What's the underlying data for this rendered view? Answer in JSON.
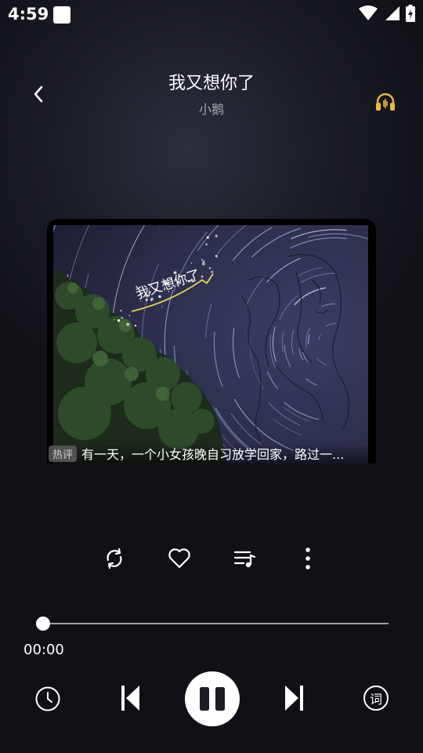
{
  "status_bar": {
    "time": "4:59"
  },
  "header": {
    "back_icon": "chevron-left-icon",
    "title": "我又想你了",
    "artist": "小鹅",
    "sound_effect_icon": "headphones-icon"
  },
  "cover": {
    "art_text": "我又想你了",
    "comment_tag": "热评",
    "comment_text": "有一天，一个小女孩晚自习放学回家，路过一..."
  },
  "actions": {
    "repeat_icon": "repeat-icon",
    "favorite_icon": "heart-icon",
    "playlist_icon": "playlist-icon",
    "more_icon": "more-vertical-icon"
  },
  "playback": {
    "elapsed": "00:00",
    "progress": 0,
    "timer_icon": "clock-icon",
    "prev_icon": "skip-previous-icon",
    "pause_icon": "pause-icon",
    "next_icon": "skip-next-icon",
    "lyrics_label": "词"
  }
}
